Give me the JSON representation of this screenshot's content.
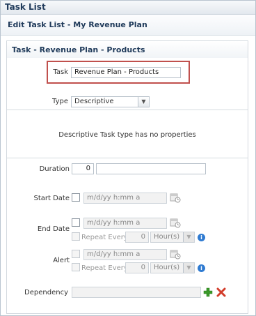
{
  "window": {
    "title": "Task List"
  },
  "header": {
    "title": "Edit Task List - My Revenue Plan"
  },
  "panel": {
    "title": "Task - Revenue Plan - Products"
  },
  "task": {
    "label": "Task",
    "value": "Revenue Plan - Products"
  },
  "type": {
    "label": "Type",
    "selected": "Descriptive"
  },
  "message": "Descriptive Task type has no properties",
  "duration": {
    "label": "Duration",
    "value": "0",
    "unit_value": ""
  },
  "start_date": {
    "label": "Start Date",
    "placeholder": "m/d/yy h:mm a"
  },
  "end_date": {
    "label": "End Date",
    "placeholder": "m/d/yy h:mm a",
    "repeat_label": "Repeat Every",
    "repeat_value": "0",
    "repeat_unit": "Hour(s)"
  },
  "alert": {
    "label": "Alert",
    "placeholder": "m/d/yy h:mm a",
    "repeat_label": "Repeat Every",
    "repeat_value": "0",
    "repeat_unit": "Hour(s)"
  },
  "dependency": {
    "label": "Dependency",
    "value": ""
  },
  "colors": {
    "highlight": "#c0504d",
    "title": "#1f3a5a",
    "add": "#3a9a2a",
    "remove": "#d23c2a",
    "info": "#2f7bd1"
  },
  "icons": {
    "calendar": "calendar-icon",
    "info": "info-icon",
    "add": "add-icon",
    "remove": "remove-icon"
  }
}
